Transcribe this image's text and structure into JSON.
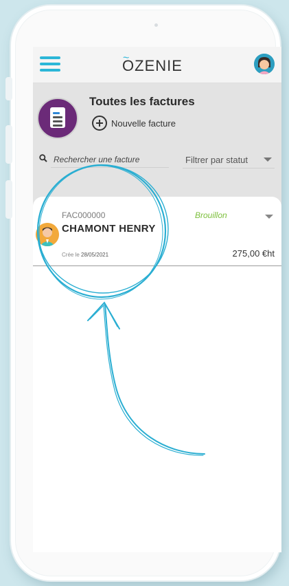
{
  "header": {
    "logo_letter": "O",
    "logo_rest": "ZENIE",
    "logo_tilde": "~"
  },
  "page": {
    "title": "Toutes les factures",
    "new_invoice_label": "Nouvelle facture"
  },
  "search": {
    "placeholder": "Rechercher une facture"
  },
  "filter": {
    "label": "Filtrer par statut"
  },
  "invoices": [
    {
      "number": "FAC000000",
      "client": "CHAMONT HENRY",
      "status": "Brouillon",
      "created_prefix": "Crée le",
      "created_date": "28/05/2021",
      "amount": "275,00 €ht"
    }
  ],
  "colors": {
    "accent": "#2bb6d7",
    "status_draft": "#7cbf3b",
    "header_icon_bg": "#6b2a78"
  },
  "icons": {
    "menu": "hamburger-icon",
    "profile": "avatar",
    "invoices": "document-icon",
    "add": "plus-circle-icon",
    "search": "search-icon",
    "expand": "chevron-down-icon"
  }
}
